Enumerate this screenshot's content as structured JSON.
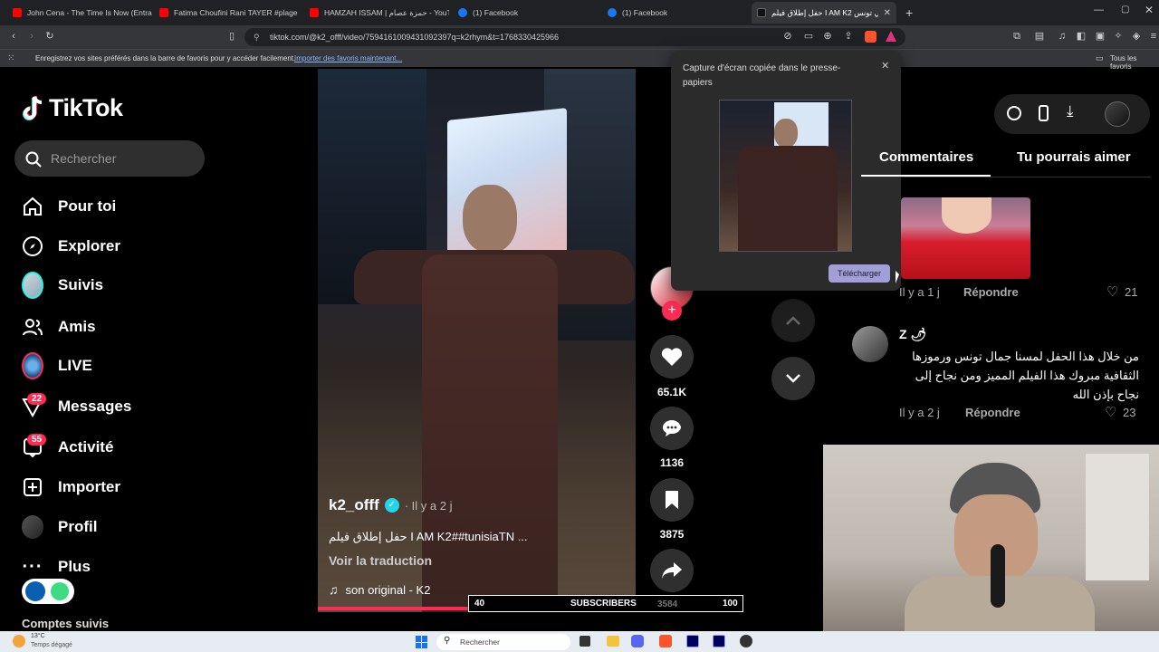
{
  "browser": {
    "tabs": [
      {
        "label": "John Cena - The Time Is Now (Entran",
        "color": "#ff0000"
      },
      {
        "label": "Fatima Choufini Rani TAYER #plage #",
        "color": "#ff0000"
      },
      {
        "label": "HAMZAH ISSAM | حمزة عصام - YouTu",
        "color": "#ff0000"
      },
      {
        "label": "(1) Facebook",
        "color": "#1877f2"
      },
      {
        "label": "(1) Facebook",
        "color": "#1877f2"
      },
      {
        "label": "حفل إطلاق فيلم I AM K2 في تونس",
        "color": "#000000"
      }
    ],
    "url": "tiktok.com/@k2_offf/video/7594161009431092397q=k2rhym&t=1768330425966",
    "bookmarks_text": "Enregistrez vos sites préférés dans la barre de favoris pour y accéder facilement.",
    "bookmarks_link": "Importer des favoris maintenant...",
    "bookmarks_right": "Tous les favoris"
  },
  "sidebar": {
    "logo": "TikTok",
    "search_placeholder": "Rechercher",
    "items": [
      {
        "label": "Pour toi",
        "icon": "home-icon"
      },
      {
        "label": "Explorer",
        "icon": "compass-icon"
      },
      {
        "label": "Suivis",
        "icon": "avatar-icon"
      },
      {
        "label": "Amis",
        "icon": "friends-icon"
      },
      {
        "label": "LIVE",
        "icon": "live-icon"
      },
      {
        "label": "Messages",
        "icon": "messages-icon",
        "badge": "22"
      },
      {
        "label": "Activité",
        "icon": "activity-icon",
        "badge": "55"
      },
      {
        "label": "Importer",
        "icon": "upload-icon"
      },
      {
        "label": "Profil",
        "icon": "profile-icon"
      },
      {
        "label": "Plus",
        "icon": "more-icon"
      }
    ],
    "following_accounts": "Comptes suivis"
  },
  "video": {
    "author": "k2_offf",
    "time": "· Il y a 2 j",
    "caption": "حفل إطلاق فيلم  I AM K2##tunisiaTN ...",
    "translate": "Voir la traduction",
    "sound": "son original - K2",
    "likes": "65.1K",
    "comments": "1136",
    "saves": "3875",
    "progress": 0.47
  },
  "overlay": {
    "subs_left": "40",
    "subs_label": "SUBSCRIBERS",
    "subs_count": "3584",
    "subs_right": "100"
  },
  "screenshot_popup": {
    "title": "Capture d'écran copiée dans le presse-papiers",
    "button": "Télécharger"
  },
  "right_panel": {
    "tabs": [
      "Commentaires",
      "Tu pourrais aimer"
    ],
    "comment1": {
      "time": "Il y a 1 j",
      "reply": "Répondre",
      "likes": "21"
    },
    "comment2": {
      "user": "Z 🌶",
      "text1": "من خلال هذا الحفل لمسنا جمال تونس ورموزها",
      "text2": "الثقافية مبروك هذا الفيلم المميز ومن نجاح إلى",
      "text3": "نجاح بإذن الله",
      "time": "Il y a 2 j",
      "reply": "Répondre",
      "likes": "23"
    }
  },
  "taskbar": {
    "weather_temp": "13°C",
    "weather_text": "Temps dégagé",
    "search": "Rechercher"
  }
}
